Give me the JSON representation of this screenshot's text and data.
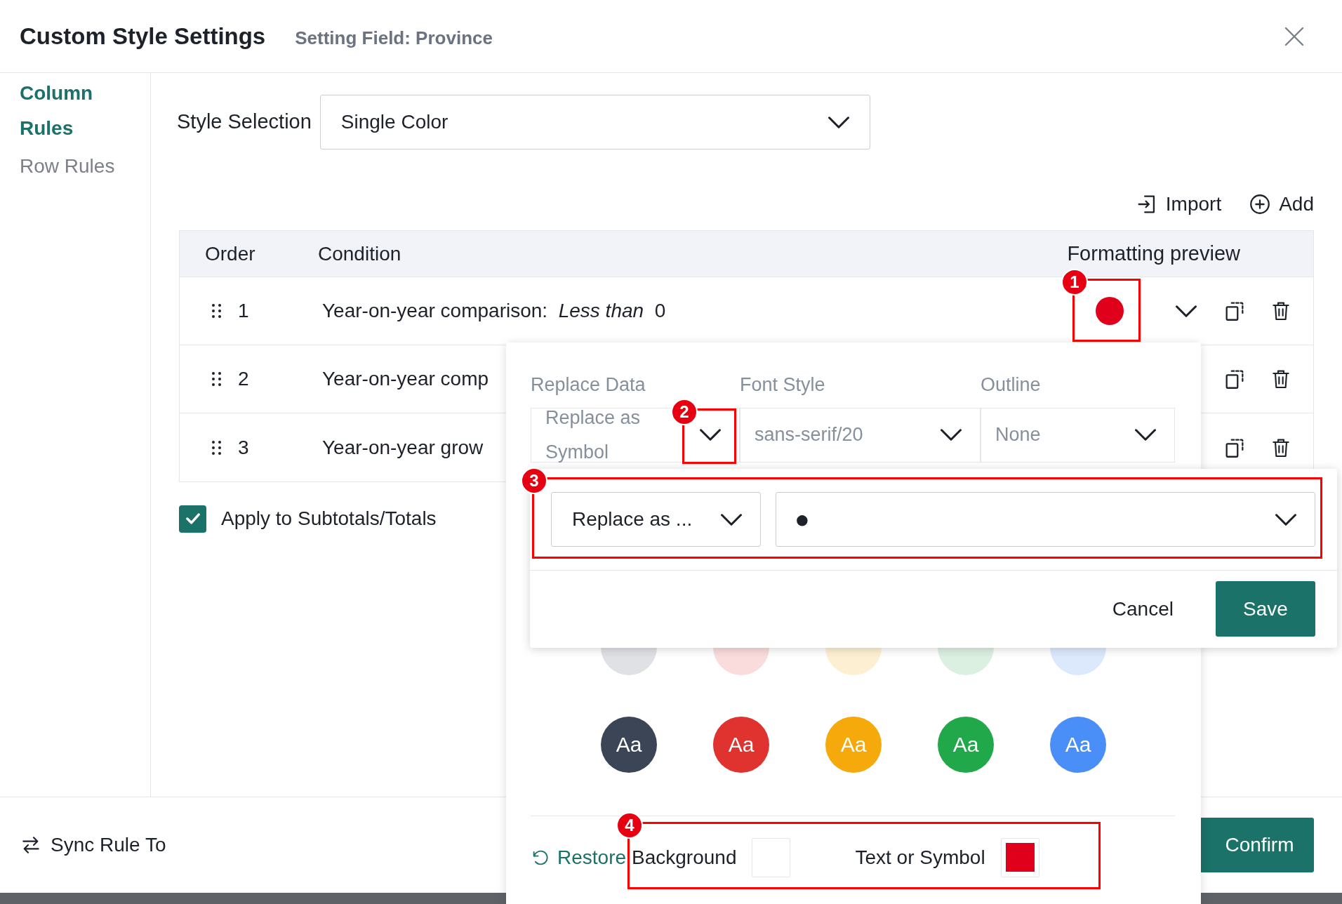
{
  "dialog": {
    "title": "Custom Style Settings",
    "subtitle": "Setting Field: Province"
  },
  "sidebar": {
    "items": [
      {
        "label": "Column Rules",
        "selected": true
      },
      {
        "label": "Row Rules",
        "selected": false
      }
    ]
  },
  "style_selection": {
    "label": "Style Selection",
    "value": "Single Color"
  },
  "toolbar": [
    "Import",
    "Add"
  ],
  "table": {
    "columns": [
      "Order",
      "Condition",
      "Formatting preview"
    ],
    "rows": [
      {
        "order": "1",
        "condition": "Year-on-year comparison:  *Less than*  0",
        "preview": {
          "color": "#e0001b"
        }
      },
      {
        "order": "2",
        "condition": "Year-on-year comp"
      },
      {
        "order": "3",
        "condition": "Year-on-year grow"
      }
    ]
  },
  "apply_totals": {
    "label": "Apply to Subtotals/Totals",
    "checked": true
  },
  "footer": {
    "sync": "Sync Rule To",
    "confirm": "Confirm"
  },
  "style_popover": {
    "labels": [
      "Replace Data",
      "Font Style",
      "Outline"
    ],
    "selects": [
      "Replace as Symbol",
      "sans-serif/20",
      "None"
    ],
    "palette": [
      {
        "color": "#dfe1e5"
      },
      {
        "color": "#f9dcdb"
      },
      {
        "color": "#fdf0d2"
      },
      {
        "color": "#dcf0e1"
      },
      {
        "color": "#dce9fd"
      },
      {
        "text": "Aa",
        "color": "#3c4556"
      },
      {
        "text": "Aa",
        "color": "#e0322e"
      },
      {
        "text": "Aa",
        "color": "#f5a90b"
      },
      {
        "text": "Aa",
        "color": "#20a84a"
      },
      {
        "text": "Aa",
        "color": "#4a8ff7"
      }
    ],
    "restore": "Restore",
    "swatches": [
      {
        "label": "Background",
        "color": "#ffffff"
      },
      {
        "label": "Text or Symbol",
        "color": "#e0001b"
      }
    ]
  },
  "replace_popover": {
    "mode": "Replace as ...",
    "symbol": "●",
    "cancel": "Cancel",
    "save": "Save"
  },
  "annotations": [
    {
      "label": "1"
    },
    {
      "label": "2"
    },
    {
      "label": "3"
    },
    {
      "label": "4"
    }
  ]
}
